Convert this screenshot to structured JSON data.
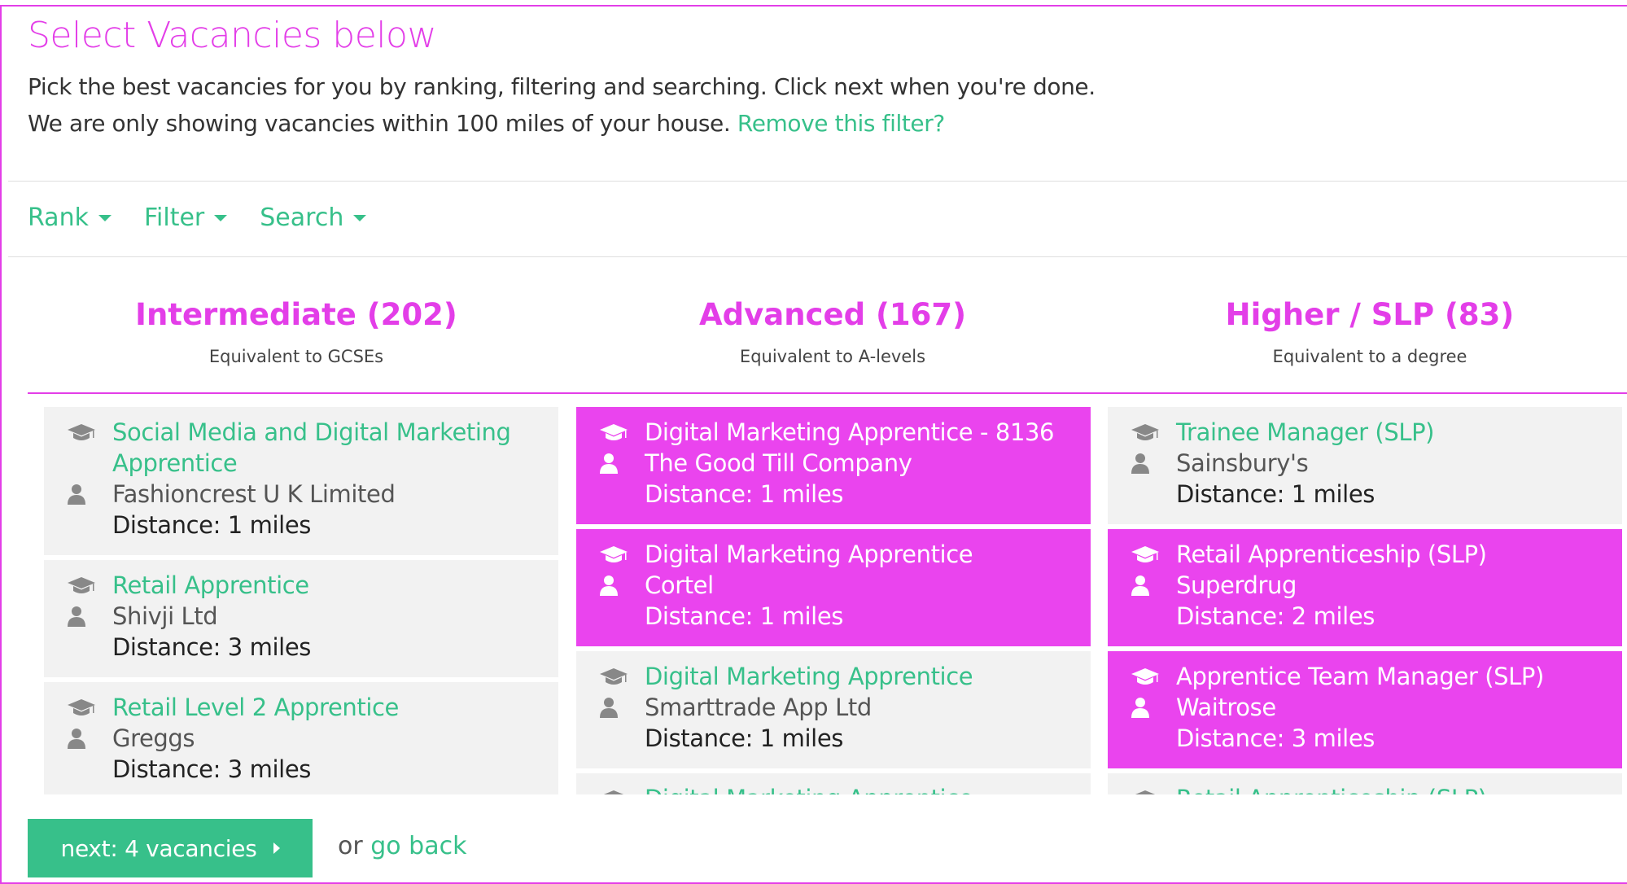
{
  "header": {
    "title": "Select Vacancies below",
    "intro_line1": "Pick the best vacancies for you by ranking, filtering and searching. Click next when you're done.",
    "intro_line2": "We are only showing vacancies within 100 miles of your house.",
    "remove_filter_link": "Remove this filter?"
  },
  "controls": {
    "rank": "Rank",
    "filter": "Filter",
    "search": "Search"
  },
  "levels": [
    {
      "title": "Intermediate (202)",
      "subtitle": "Equivalent to GCSEs"
    },
    {
      "title": "Advanced (167)",
      "subtitle": "Equivalent to A-levels"
    },
    {
      "title": "Higher / SLP (83)",
      "subtitle": "Equivalent to a degree"
    }
  ],
  "columns": [
    {
      "cards": [
        {
          "title": "Social Media and Digital Marketing Apprentice",
          "company": "Fashioncrest U K Limited",
          "distance": "Distance: 1 miles",
          "selected": false
        },
        {
          "title": "Retail Apprentice",
          "company": "Shivji Ltd",
          "distance": "Distance: 3 miles",
          "selected": false
        },
        {
          "title": "Retail Level 2 Apprentice",
          "company": "Greggs",
          "distance": "Distance: 3 miles",
          "selected": false
        }
      ]
    },
    {
      "cards": [
        {
          "title": "Digital Marketing Apprentice - 8136",
          "company": "The Good Till Company",
          "distance": "Distance: 1 miles",
          "selected": true
        },
        {
          "title": "Digital Marketing Apprentice",
          "company": "Cortel",
          "distance": "Distance: 1 miles",
          "selected": true
        },
        {
          "title": "Digital Marketing Apprentice",
          "company": "Smarttrade App Ltd",
          "distance": "Distance: 1 miles",
          "selected": false
        },
        {
          "title": "Digital Marketing Apprentice",
          "company": "",
          "distance": "",
          "selected": false
        }
      ]
    },
    {
      "cards": [
        {
          "title": "Trainee Manager (SLP)",
          "company": "Sainsbury's",
          "distance": "Distance: 1 miles",
          "selected": false
        },
        {
          "title": "Retail Apprenticeship (SLP)",
          "company": "Superdrug",
          "distance": "Distance: 2 miles",
          "selected": true
        },
        {
          "title": "Apprentice Team Manager (SLP)",
          "company": "Waitrose",
          "distance": "Distance: 3 miles",
          "selected": true
        },
        {
          "title": "Retail Apprenticeship (SLP)",
          "company": "",
          "distance": "",
          "selected": false
        }
      ]
    }
  ],
  "footer": {
    "next_button": "next: 4 vacancies",
    "or_text": "or",
    "go_back_link": "go back"
  },
  "colors": {
    "brand_pink": "#e33ee8",
    "selected_card": "#ea44ee",
    "accent_green": "#37c08a",
    "card_background": "#f2f2f2"
  },
  "icons": {
    "title_icon": "graduation-cap-icon",
    "company_icon": "user-icon",
    "dropdown_icon": "caret-down-icon",
    "button_icon": "caret-right-icon"
  }
}
